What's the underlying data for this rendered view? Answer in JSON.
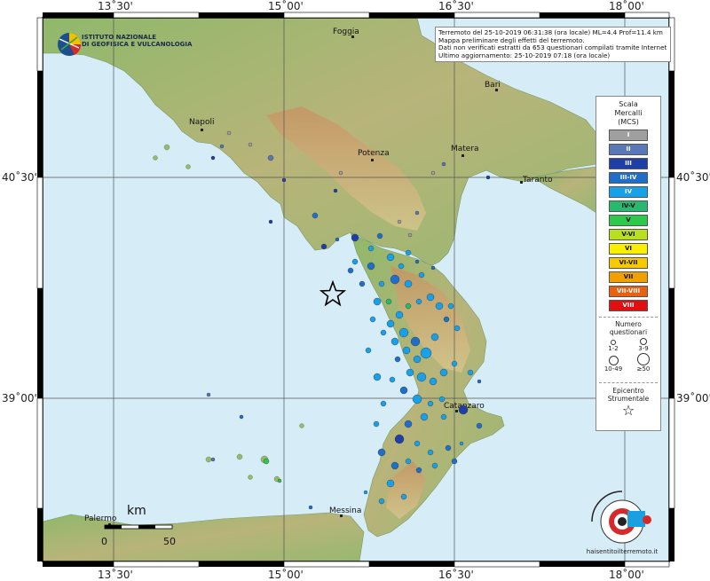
{
  "map": {
    "top_labels": [
      "13˚30'",
      "15˚00'",
      "16˚30'",
      "18˚00'"
    ],
    "bottom_labels": [
      "13˚30'",
      "15˚00'",
      "16˚30'",
      "18˚00'"
    ],
    "left_labels": [
      "40˚30'",
      "39˚00'"
    ],
    "right_labels": [
      "40˚30'",
      "39˚00'"
    ],
    "cities": {
      "foggia": "Foggia",
      "bari": "Bari",
      "napoli": "Napoli",
      "potenza": "Potenza",
      "matera": "Matera",
      "taranto": "Taranto",
      "catanzaro": "Catanzaro",
      "palermo": "Palermo",
      "messina": "Messina"
    }
  },
  "logo": {
    "line1": "ISTITUTO NAZIONALE",
    "line2": "DI GEOFISICA E VULCANOLOGIA"
  },
  "info": {
    "line1": "Terremoto del 25-10-2019 06:31:38 (ora locale) ML=4.4 Prof=11.4 km",
    "line2": "Mappa preliminare degli effetti del terremoto.",
    "line3": "Dati non verificati estratti da 653 questionari compilati tramite Internet.",
    "line4": "Ultimo aggiornamento: 25-10-2019 07:18 (ora locale)"
  },
  "legend": {
    "title1": "Scala",
    "title2": "Mercalli",
    "title3": "(MCS)",
    "scale": [
      {
        "label": "I",
        "color": "#a0a0a0",
        "text": "#ffffff"
      },
      {
        "label": "II",
        "color": "#5878b8",
        "text": "#ffffff"
      },
      {
        "label": "III",
        "color": "#1f3fa8",
        "text": "#ffffff"
      },
      {
        "label": "III-IV",
        "color": "#1f6fc8",
        "text": "#ffffff"
      },
      {
        "label": "IV",
        "color": "#18a0e8",
        "text": "#ffffff"
      },
      {
        "label": "IV-V",
        "color": "#28b870",
        "text": "#111111"
      },
      {
        "label": "V",
        "color": "#2ec84a",
        "text": "#111111"
      },
      {
        "label": "V-VI",
        "color": "#b8e020",
        "text": "#111111"
      },
      {
        "label": "VI",
        "color": "#f8f000",
        "text": "#111111"
      },
      {
        "label": "VI-VII",
        "color": "#f8c800",
        "text": "#111111"
      },
      {
        "label": "VII",
        "color": "#f0a000",
        "text": "#111111"
      },
      {
        "label": "VII-VIII",
        "color": "#e86010",
        "text": "#ffffff"
      },
      {
        "label": "VIII",
        "color": "#e01010",
        "text": "#ffffff"
      }
    ],
    "questionari_title1": "Numero",
    "questionari_title2": "questionari",
    "q_labels": [
      "1-2",
      "3-9",
      "10-49",
      "≥50"
    ],
    "epicentro1": "Epicentro",
    "epicentro2": "Strumentale",
    "star": "☆"
  },
  "scalebar": {
    "unit": "km",
    "start": "0",
    "end": "50"
  },
  "brand": {
    "text": "haisentitoilterremoto.it",
    "www": "www"
  },
  "colors": {
    "sea": "#d8eef8",
    "land_low": "#7fae5e",
    "land_mid": "#c9c08a",
    "land_high": "#b07a4a"
  }
}
